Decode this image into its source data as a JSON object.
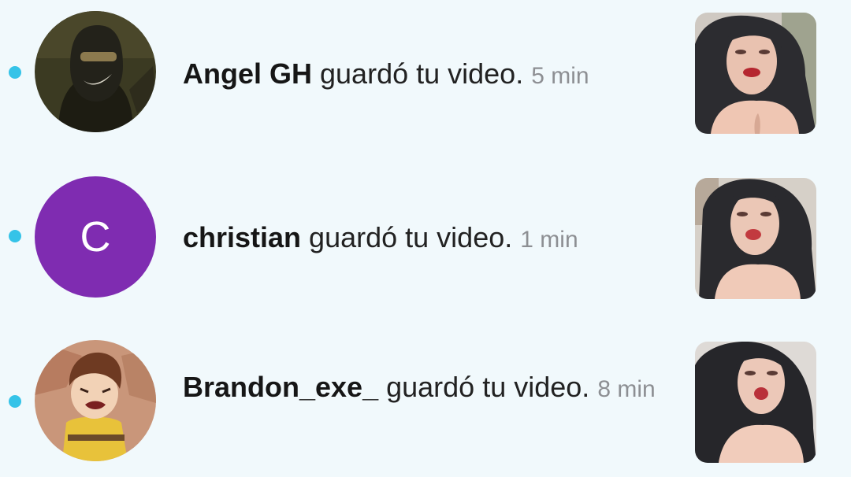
{
  "notifications": [
    {
      "username": "Angel GH",
      "action": " guardó tu video.",
      "time": "5 min",
      "avatar_icon": "masked-person-avatar",
      "unread": true
    },
    {
      "username": "christian",
      "action": " guardó tu video.",
      "time": "1 min",
      "avatar_letter": "C",
      "avatar_color": "#7f2cb1",
      "unread": true
    },
    {
      "username": "Brandon_exe_",
      "action": " guardó tu video.",
      "time": "8 min",
      "avatar_icon": "cartoon-character-avatar",
      "unread": true
    }
  ],
  "colors": {
    "background": "#f1f9fc",
    "unread_dot": "#35c3e8",
    "time_text": "#8d8f93"
  }
}
